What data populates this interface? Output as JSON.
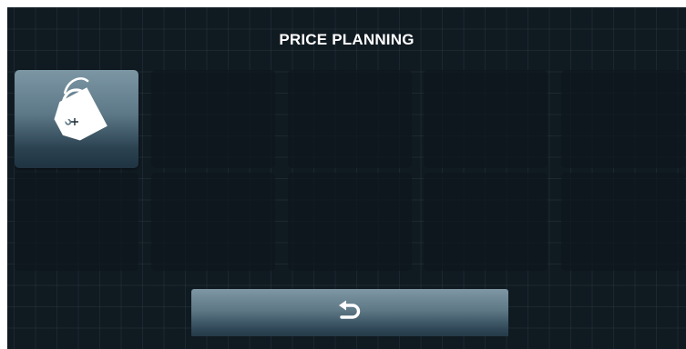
{
  "header": {
    "title": "PRICE PLANNING"
  },
  "tiles": [
    {
      "icon": "price-tag-add-icon",
      "active": true
    },
    {
      "active": false
    },
    {
      "active": false
    },
    {
      "active": false
    },
    {
      "active": false
    },
    {
      "active": false
    },
    {
      "active": false
    },
    {
      "active": false
    },
    {
      "active": false
    },
    {
      "active": false
    }
  ],
  "footer": {
    "back_icon": "return-arrow-icon"
  },
  "colors": {
    "background": "#101a21",
    "tile": "#0e161c",
    "button_top": "#7f97a5",
    "button_bottom": "#243a48",
    "text": "#ffffff"
  }
}
